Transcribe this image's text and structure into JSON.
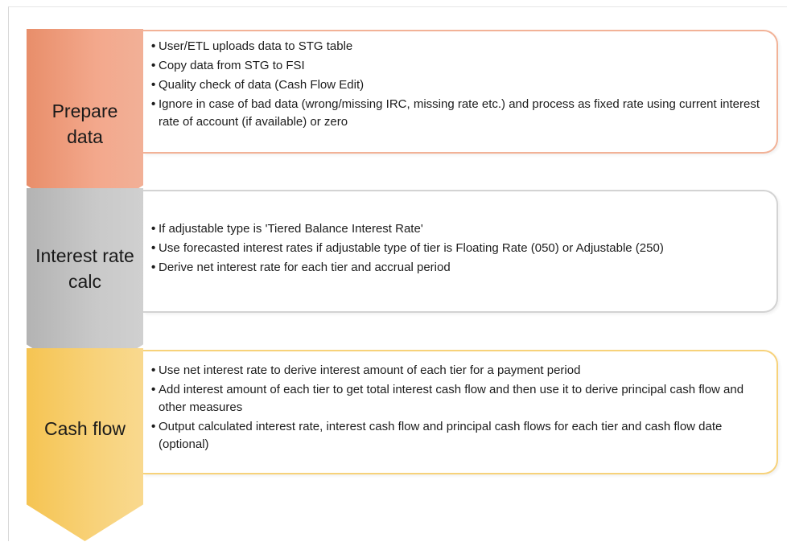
{
  "steps": [
    {
      "label": "Prepare data",
      "color": "#f3a88c",
      "items": [
        "User/ETL uploads data to STG table",
        "Copy data from STG to FSI",
        "Quality check of data (Cash Flow Edit)",
        "Ignore in case of bad data (wrong/missing IRC, missing rate etc.) and process as fixed rate using current interest rate of account (if available) or zero"
      ]
    },
    {
      "label": "Interest rate calc",
      "color": "#c9c9c9",
      "items": [
        "If adjustable type is 'Tiered Balance Interest Rate'",
        "Use forecasted interest rates if adjustable type of tier is Floating Rate (050) or Adjustable (250)",
        "Derive net interest rate for each tier and accrual period"
      ]
    },
    {
      "label": "Cash flow",
      "color": "#f8d27a",
      "items": [
        "Use net interest rate to derive interest amount of each tier for a payment period",
        "Add interest amount of each tier to get total interest cash flow and then use it to  derive principal cash flow and other measures",
        "Output calculated interest rate, interest cash flow and principal cash flows for each tier and cash flow date (optional)"
      ]
    }
  ]
}
